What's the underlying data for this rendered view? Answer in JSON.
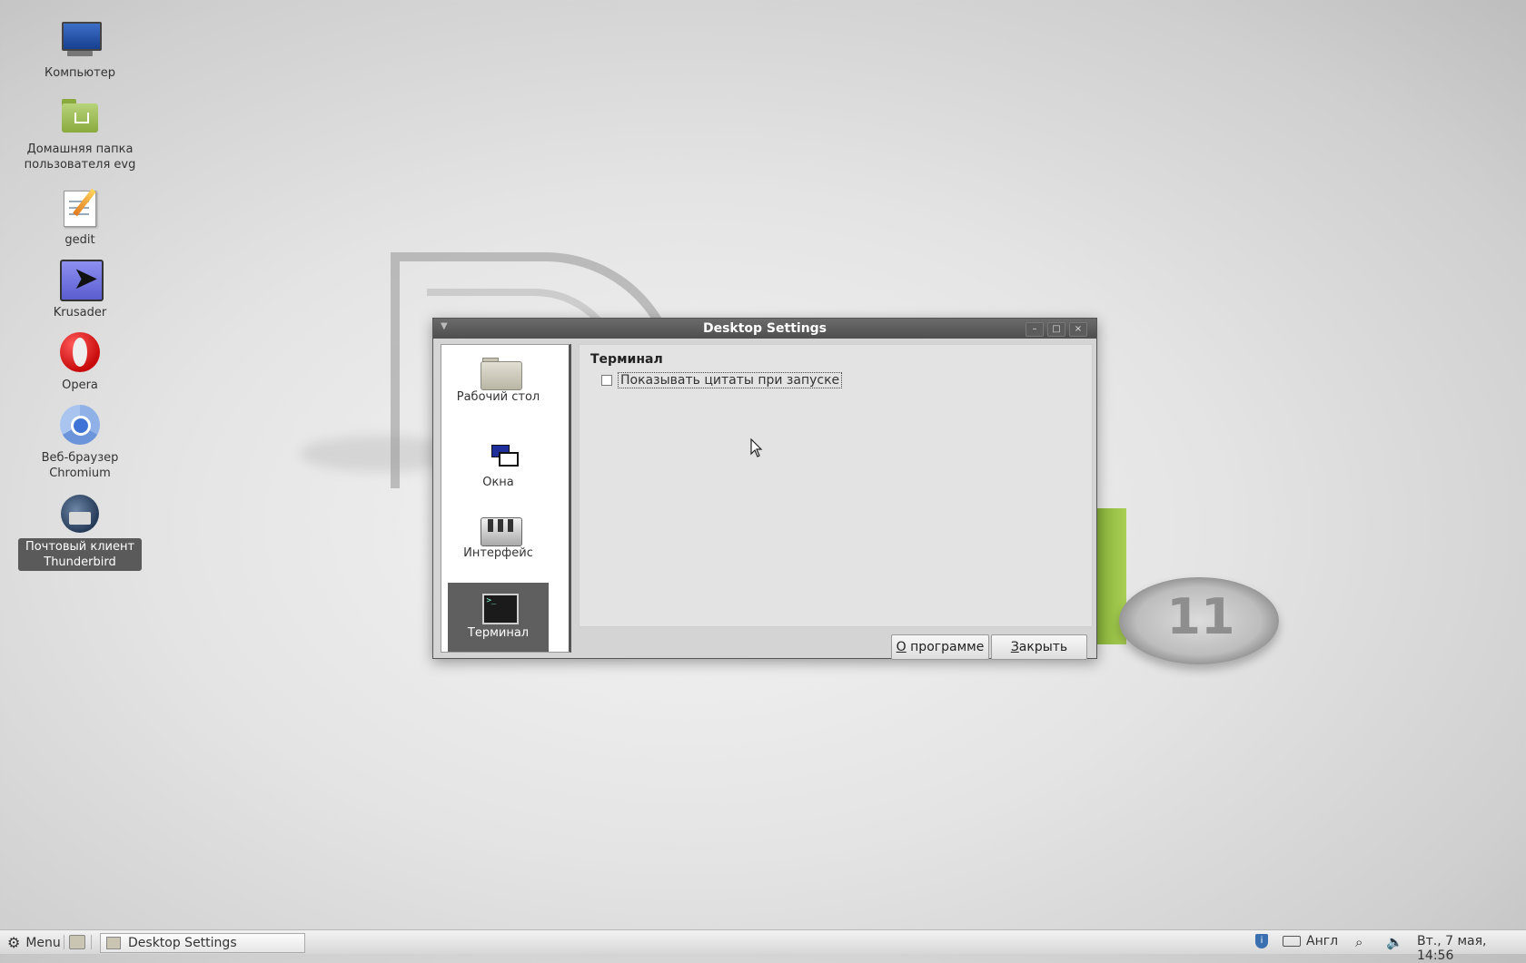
{
  "desktop": {
    "icons": [
      {
        "label": "Компьютер",
        "icon": "computer-icon"
      },
      {
        "label": "Домашняя папка пользователя evg",
        "icon": "home-folder-icon"
      },
      {
        "label": "gedit",
        "icon": "gedit-icon"
      },
      {
        "label": "Krusader",
        "icon": "krusader-icon"
      },
      {
        "label": "Opera",
        "icon": "opera-icon"
      },
      {
        "label": "Веб-браузер Chromium",
        "icon": "chromium-icon"
      },
      {
        "label": "Почтовый клиент Thunderbird",
        "icon": "thunderbird-icon",
        "selected": true
      }
    ],
    "wallpaper_text": "11"
  },
  "dialog": {
    "title": "Desktop Settings",
    "sidebar": [
      {
        "label": "Рабочий стол",
        "icon": "desktop-folder-icon"
      },
      {
        "label": "Окна",
        "icon": "windows-icon"
      },
      {
        "label": "Интерфейс",
        "icon": "interface-mixer-icon"
      },
      {
        "label": "Терминал",
        "icon": "terminal-icon",
        "active": true
      }
    ],
    "section_title": "Терминал",
    "checkbox": {
      "label": "Показывать цитаты при запуске",
      "checked": false
    },
    "buttons": {
      "about_mnemonic": "О",
      "about_rest": " программе",
      "close_mnemonic": "З",
      "close_rest": "акрыть"
    },
    "window_controls": {
      "minimize": "–",
      "maximize": "□",
      "close": "×"
    }
  },
  "panel": {
    "menu_label": "Menu",
    "task_label": "Desktop Settings",
    "layout": "Англ",
    "clock": "Вт., 7 мая, 14:56"
  },
  "colors": {
    "accent_green": "#8aaa3e",
    "titlebar": "#5a5a5a",
    "selection": "#5f5f5f"
  }
}
